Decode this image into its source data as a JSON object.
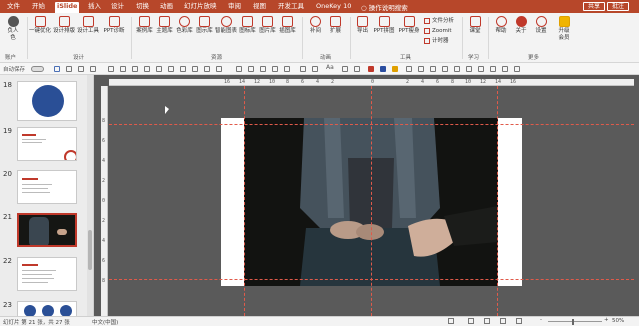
{
  "tabs": [
    {
      "label": "文件",
      "active": false
    },
    {
      "label": "开始",
      "active": false
    },
    {
      "label": "iSlide",
      "active": true
    },
    {
      "label": "插入",
      "active": false
    },
    {
      "label": "设计",
      "active": false
    },
    {
      "label": "切换",
      "active": false
    },
    {
      "label": "动画",
      "active": false
    },
    {
      "label": "幻灯片放映",
      "active": false
    },
    {
      "label": "审阅",
      "active": false
    },
    {
      "label": "视图",
      "active": false
    },
    {
      "label": "开发工具",
      "active": false
    },
    {
      "label": "OneKey 10",
      "active": false
    }
  ],
  "search": {
    "label": "操作说明搜索"
  },
  "header_buttons": {
    "share": "共享",
    "comment": "批注"
  },
  "ribbon": {
    "account": {
      "label": "负人\n色",
      "group": "账户"
    },
    "design_buttons": [
      "一键优化",
      "设计排版",
      "设计工具",
      "PPT诊断"
    ],
    "design_group": "设计",
    "resource_buttons": [
      "案例库",
      "主题库",
      "色彩库",
      "图示库",
      "智能图表",
      "图标库",
      "图片库",
      "插图库"
    ],
    "resource_group": "资源",
    "anim_buttons": [
      "补间",
      "扩展"
    ],
    "anim_group": "动画",
    "tool_buttons": [
      "导出",
      "PPT拼图",
      "PPT瘦身"
    ],
    "tool_small": [
      "文件分析",
      "Zoomit",
      "计时器"
    ],
    "tool_group": "工具",
    "learn_buttons": [
      "课堂"
    ],
    "learn_group": "学习",
    "more_buttons": [
      "帮助",
      "关于",
      "设置",
      "升级\n会员"
    ],
    "more_group": "更多"
  },
  "quick_access": {
    "autosave_label": "自动保存"
  },
  "slides": [
    {
      "num": "18"
    },
    {
      "num": "19"
    },
    {
      "num": "20"
    },
    {
      "num": "21",
      "selected": true
    },
    {
      "num": "22"
    },
    {
      "num": "23"
    }
  ],
  "ruler": {
    "h_ticks": [
      "16",
      "14",
      "12",
      "10",
      "8",
      "6",
      "4",
      "2",
      "0",
      "2",
      "4",
      "6",
      "8",
      "10",
      "12",
      "14",
      "16"
    ],
    "v_ticks": [
      "8",
      "6",
      "4",
      "2",
      "0",
      "2",
      "4",
      "6",
      "8"
    ]
  },
  "status": {
    "slide_info": "幻灯片 第 21 张，共 27 张",
    "language": "中文(中国)",
    "zoom": "50%"
  },
  "colors": {
    "accent": "#b7472a",
    "guide": "#e05a4a",
    "canvas_bg": "#5a5a5a"
  }
}
